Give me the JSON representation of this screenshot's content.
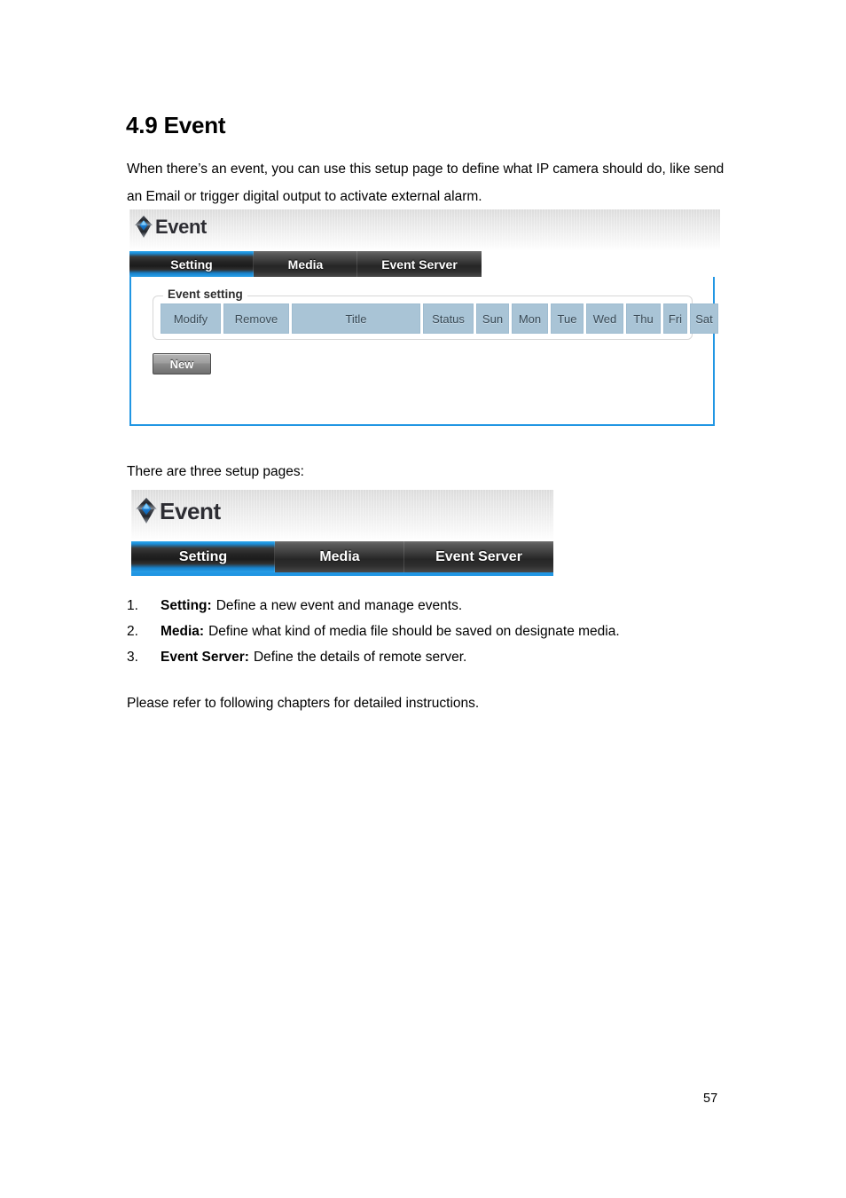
{
  "document": {
    "heading": "4.9 Event",
    "intro": "When there’s an event, you can use this setup page to define what IP camera should do, like send an Email or trigger digital output to activate external alarm.",
    "three_pages_line": "There are three setup pages:",
    "closing_line": "Please refer to following chapters for detailed instructions.",
    "page_number": "57",
    "list": [
      {
        "num": "1.",
        "term": "Setting:",
        "desc": "Define a new event and manage events."
      },
      {
        "num": "2.",
        "term": "Media:",
        "desc": "Define what kind of media file should be saved on designate media."
      },
      {
        "num": "3.",
        "term": "Event Server:",
        "desc": "Define the details of remote server."
      }
    ]
  },
  "colors": {
    "accent_blue": "#2196e3",
    "tab_active_blue": "#1b8dd8",
    "tab_inactive_gray": "#3c3c3c",
    "table_header_blue": "#a9c4d6",
    "header_gradient_top": "#dcdcdc",
    "header_gradient_bottom": "#ffffff",
    "brand_text": "#2d2d33",
    "button_gray": "#9e9e9e"
  },
  "screenshot_event_panel": {
    "brand": {
      "title": "Event",
      "icon": "event-diamond-logo-icon"
    },
    "tabs": [
      {
        "label": "Setting",
        "active": true
      },
      {
        "label": "Media",
        "active": false
      },
      {
        "label": "Event Server",
        "active": false
      }
    ],
    "fieldset": {
      "legend": "Event setting"
    },
    "table": {
      "columns": [
        "Modify",
        "Remove",
        "Title",
        "Status",
        "Sun",
        "Mon",
        "Tue",
        "Wed",
        "Thu",
        "Fri",
        "Sat"
      ],
      "rows": []
    },
    "buttons": {
      "new": "New"
    }
  },
  "screenshot_tabs_only": {
    "brand": {
      "title": "Event",
      "icon": "event-diamond-logo-icon"
    },
    "tabs": [
      {
        "label": "Setting",
        "active": true
      },
      {
        "label": "Media",
        "active": false
      },
      {
        "label": "Event Server",
        "active": false
      }
    ]
  }
}
